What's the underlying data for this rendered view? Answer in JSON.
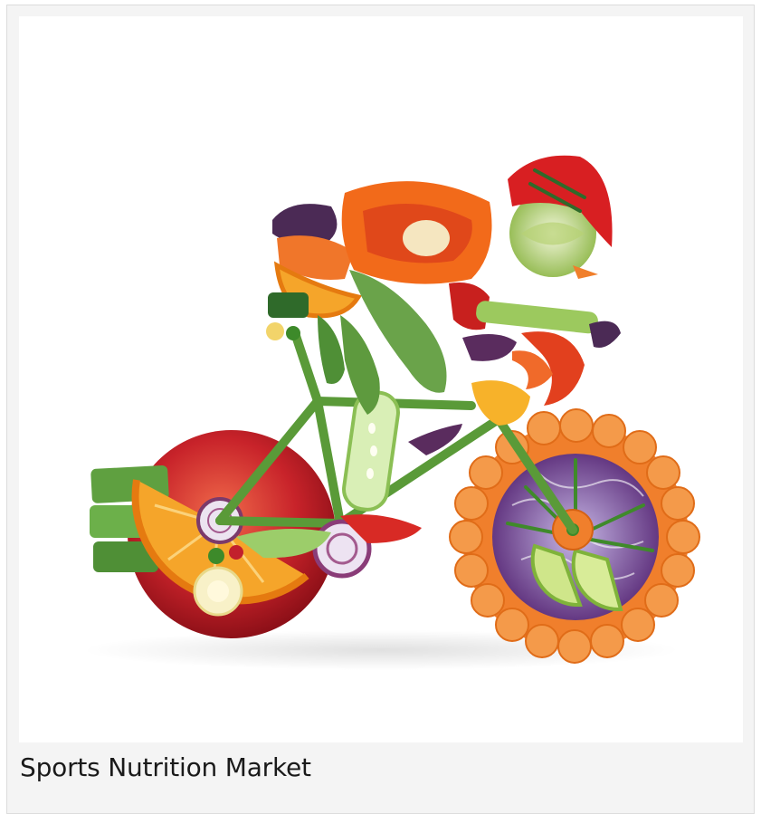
{
  "card": {
    "caption": "Sports Nutrition Market",
    "image_subject": "illustration-cyclist-made-of-fruits-and-vegetables"
  },
  "colors": {
    "card_background": "#f4f4f4",
    "card_border": "#dcdcdc",
    "caption_text": "#1a1a1a",
    "image_background": "#ffffff"
  }
}
